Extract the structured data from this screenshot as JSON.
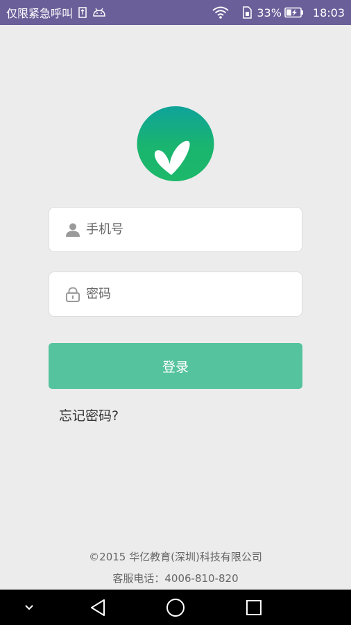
{
  "status_bar": {
    "carrier": "仅限紧急呼叫",
    "battery_percent": "33%",
    "time": "18:03",
    "icons": [
      "sim-icon",
      "android-debug-icon",
      "wifi-icon",
      "sim-card-icon",
      "battery-charging-icon"
    ]
  },
  "logo": {
    "icon": "sprout-logo-icon",
    "colors": [
      "#0fa39a",
      "#1db86a"
    ]
  },
  "form": {
    "phone": {
      "placeholder": "手机号",
      "value": "",
      "icon": "user-icon"
    },
    "password": {
      "placeholder": "密码",
      "value": "",
      "icon": "lock-icon"
    },
    "login_label": "登录",
    "forgot_label": "忘记密码?"
  },
  "footer": {
    "copyright": "©2015 华亿教育(深圳)科技有限公司",
    "hotline": "客服电话：4006-810-820"
  },
  "nav_bar": {
    "icons": [
      "collapse-chevron-icon",
      "back-triangle-icon",
      "home-circle-icon",
      "recents-square-icon"
    ]
  },
  "colors": {
    "status_bar": "#6a5f99",
    "background": "#ececec",
    "button": "#55c39d",
    "nav_bar": "#000000"
  }
}
